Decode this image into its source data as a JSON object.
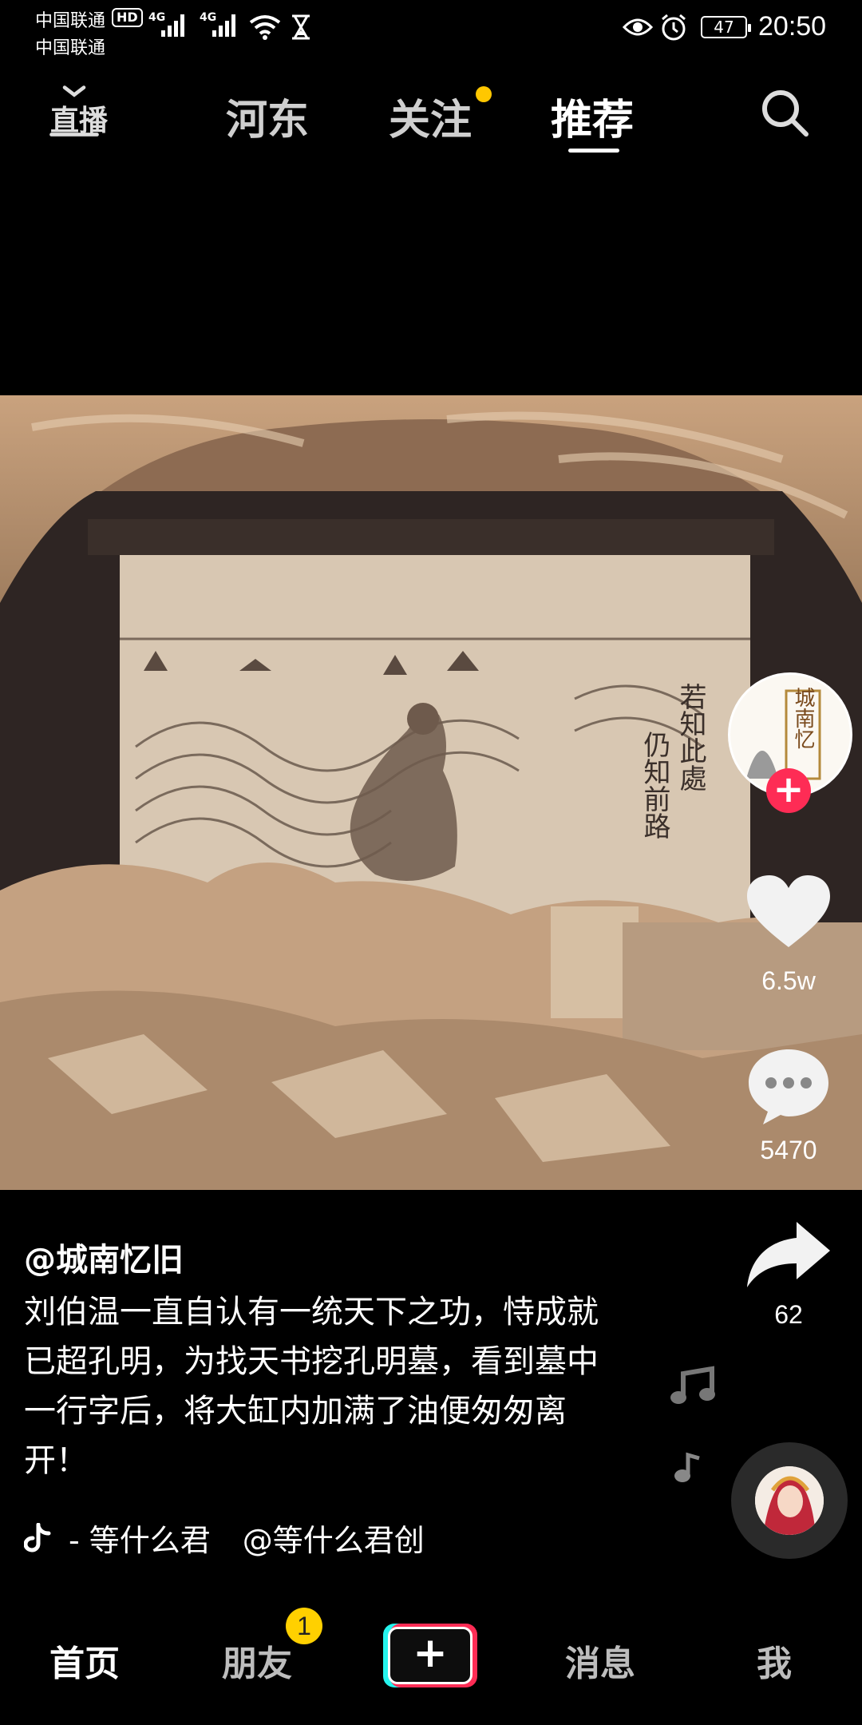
{
  "status_bar": {
    "carrier_1": "中国联通",
    "carrier_2": "中国联通",
    "hd": "HD",
    "network_1": "4G",
    "network_2": "4G",
    "battery": "47",
    "time": "20:50"
  },
  "top_nav": {
    "live_label": "直播",
    "tabs": [
      {
        "label": "河东"
      },
      {
        "label": "关注"
      },
      {
        "label": "推荐"
      }
    ],
    "active_tab": "推荐"
  },
  "video": {
    "inscription_1": "若知此處",
    "inscription_2": "仍知前路"
  },
  "right_rail": {
    "author_avatar_text": "城南忆",
    "likes": "6.5w",
    "comments": "5470",
    "shares": "62"
  },
  "post": {
    "author": "@城南忆旧",
    "caption": "刘伯温一直自认有一统天下之功，恃成就已超孔明，为找天书挖孔明墓，看到墓中一行字后，将大缸内加满了油便匆匆离开！",
    "music_track": "- 等什么君",
    "music_creator": "@等什么君创"
  },
  "bottom_nav": {
    "items": [
      {
        "label": "首页"
      },
      {
        "label": "朋友"
      },
      {
        "label": "消息"
      },
      {
        "label": "我"
      }
    ],
    "friends_badge": "1",
    "create_label": "+"
  },
  "colors": {
    "accent_red": "#fe2c55",
    "accent_cyan": "#25f4ee",
    "badge_yellow": "#ffd000"
  }
}
